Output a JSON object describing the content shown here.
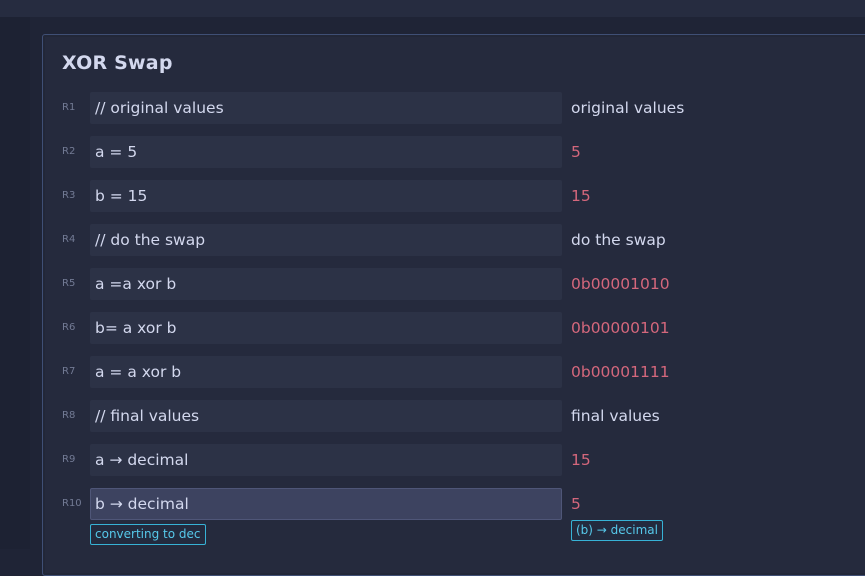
{
  "sheet": {
    "title": "XOR Swap",
    "rows": [
      {
        "label": "R1",
        "expression": "// original values",
        "result": "original values"
      },
      {
        "label": "R2",
        "expression": "a = 5",
        "result": "5"
      },
      {
        "label": "R3",
        "expression": "b = 15",
        "result": "15"
      },
      {
        "label": "R4",
        "expression": "// do the swap",
        "result": "do the swap"
      },
      {
        "label": "R5",
        "expression": "a =a xor b",
        "result": "0b00001010"
      },
      {
        "label": "R6",
        "expression": "b= a xor b",
        "result": "0b00000101"
      },
      {
        "label": "R7",
        "expression": "a = a xor b",
        "result": "0b00001111"
      },
      {
        "label": "R8",
        "expression": "// final values",
        "result": "final values"
      },
      {
        "label": "R9",
        "expression": "a → decimal",
        "result": "15"
      },
      {
        "label": "R10",
        "expression": "b → decimal",
        "result": "5"
      }
    ],
    "active_row_tip": "converting to dec",
    "active_result_tip": "(b) → decimal"
  },
  "colors": {
    "background": "#1f2436",
    "panel": "#252a3d",
    "text": "#d3d8ee",
    "number_result": "#d4677c",
    "tip_accent": "#37b2d6"
  }
}
